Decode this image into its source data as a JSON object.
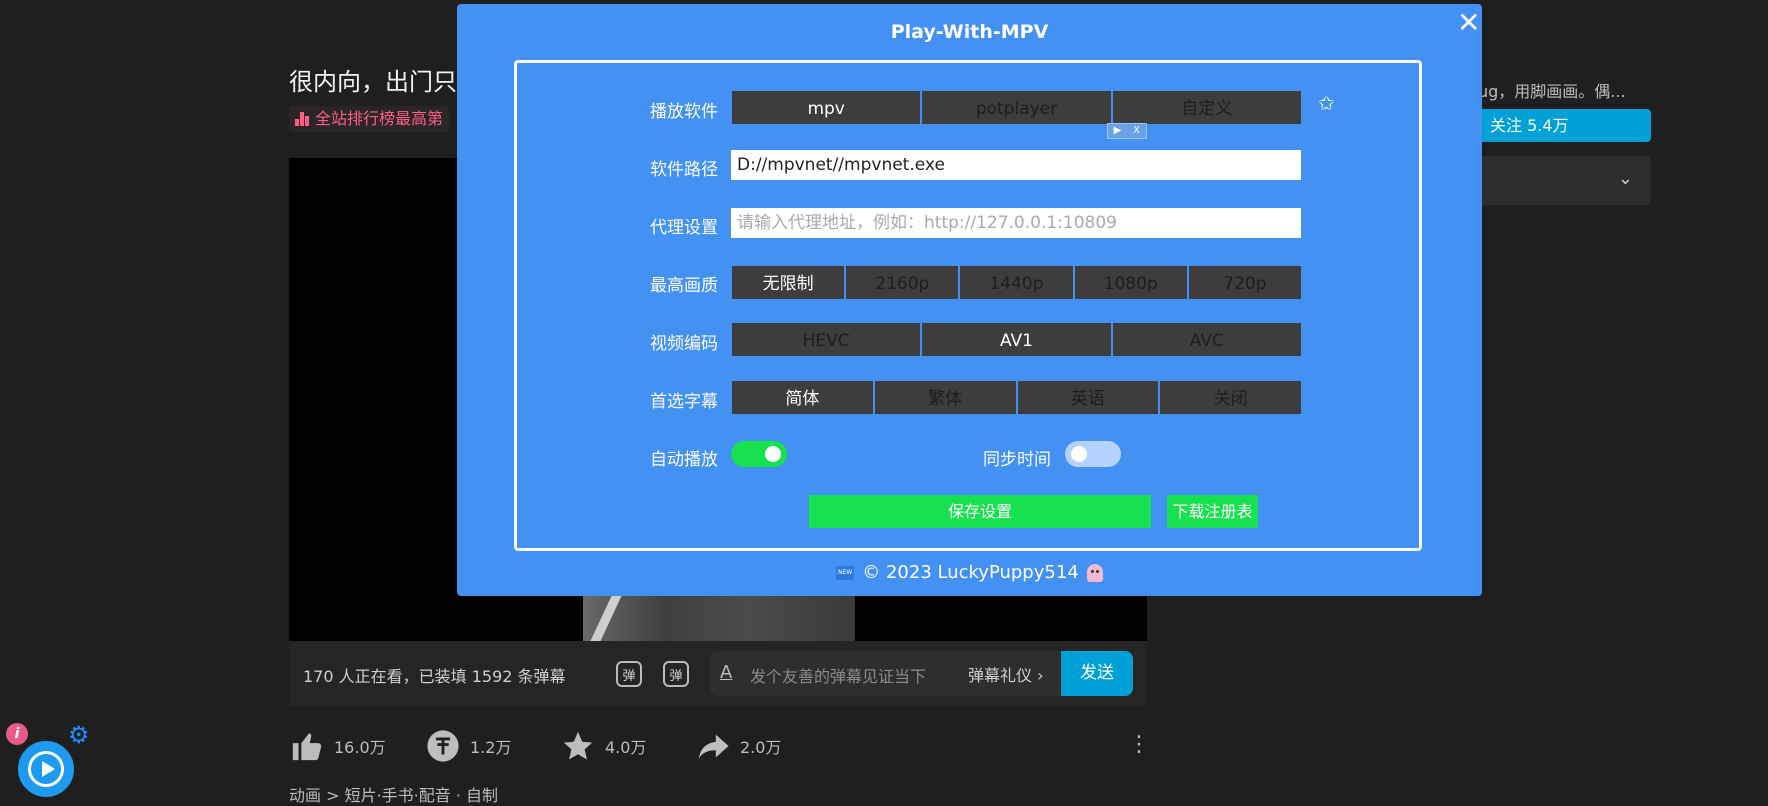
{
  "page": {
    "video_title": "很内向，出门只",
    "rank_badge": "全站排行榜最高第",
    "watching_text": "170 人正在看，已装填 1592 条弹幕",
    "danmaku_icon_1": "弹",
    "danmaku_icon_2": "弹",
    "danmaku_placeholder": "发个友善的弹幕见证当下",
    "danmaku_etiquette": "弹幕礼仪 ›",
    "danmaku_send": "发送",
    "actions": [
      {
        "name": "like",
        "count": "16.0万"
      },
      {
        "name": "coin",
        "count": "1.2万"
      },
      {
        "name": "favorite",
        "count": "4.0万"
      },
      {
        "name": "share",
        "count": "2.0万"
      }
    ],
    "breadcrumb": "动画 > 短片·手书·配音 · 自制",
    "up_description": "ug，用脚画画。偶...",
    "follow_label": "关注 5.4万",
    "more_icon": "⋮",
    "dropdown_icon": "⌄"
  },
  "modal": {
    "title": "Play-With-MPV",
    "close_icon": "✕",
    "player_label": "播放软件",
    "players": [
      "mpv",
      "potplayer",
      "自定义"
    ],
    "player_selected": "mpv",
    "path_label": "软件路径",
    "path_value": "D://mpvnet//mpvnet.exe",
    "proxy_label": "代理设置",
    "proxy_placeholder": "请输入代理地址，例如：http://127.0.0.1:10809",
    "quality_label": "最高画质",
    "qualities": [
      "无限制",
      "2160p",
      "1440p",
      "1080p",
      "720p"
    ],
    "quality_selected": "无限制",
    "codec_label": "视频编码",
    "codecs": [
      "HEVC",
      "AV1",
      "AVC"
    ],
    "codec_selected": "AV1",
    "subtitle_label": "首选字幕",
    "subtitles": [
      "简体",
      "繁体",
      "英语",
      "关闭"
    ],
    "subtitle_selected": "简体",
    "autoplay_label": "自动播放",
    "autoplay_on": true,
    "sync_label": "同步时间",
    "sync_on": false,
    "save_label": "保存设置",
    "register_label": "下载注册表",
    "footer_text": "© 2023 LuckyPuppy514",
    "new_badge": "NEW",
    "ad_badge": [
      "▶",
      "X"
    ]
  },
  "colors": {
    "modal_bg": "#4391f2",
    "button_green": "#16e14e",
    "segment_bg": "#3d3d3d",
    "accent_blue": "#00a1d6",
    "rank_pink": "#ff5c8a"
  },
  "icons": [
    "thumb-up-icon",
    "coin-icon",
    "star-icon",
    "share-icon",
    "pin-icon",
    "gear-icon",
    "info-icon",
    "play-icon",
    "close-icon",
    "chevron-down-icon"
  ]
}
